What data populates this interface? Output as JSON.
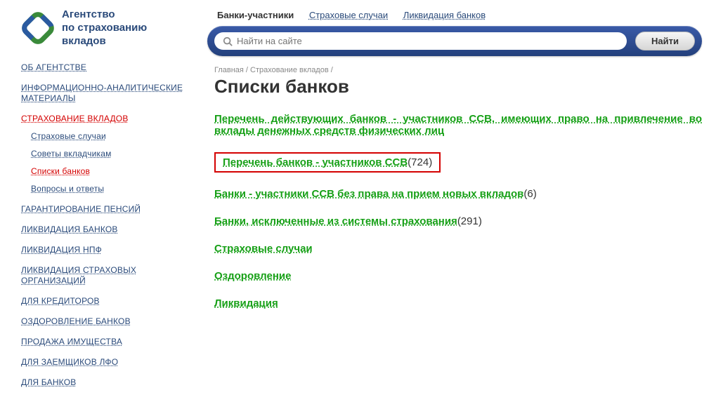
{
  "logo": {
    "line1": "Агентство",
    "line2": "по страхованию",
    "line3": "вкладов"
  },
  "top_nav": {
    "active": "Банки-участники",
    "link1": "Страховые случаи",
    "link2": "Ликвидация банков"
  },
  "search": {
    "placeholder": "Найти на сайте",
    "button": "Найти"
  },
  "sidebar": {
    "items": [
      {
        "label": "ОБ АГЕНТСТВЕ"
      },
      {
        "label": "ИНФОРМАЦИОННО-АНАЛИТИЧЕСКИЕ МАТЕРИАЛЫ"
      },
      {
        "label": "СТРАХОВАНИЕ ВКЛАДОВ",
        "sub": [
          {
            "label": "Страховые случаи"
          },
          {
            "label": "Советы вкладчикам"
          },
          {
            "label": "Списки банков",
            "active": true
          },
          {
            "label": "Вопросы и ответы"
          }
        ]
      },
      {
        "label": "ГАРАНТИРОВАНИЕ ПЕНСИЙ"
      },
      {
        "label": "ЛИКВИДАЦИЯ БАНКОВ"
      },
      {
        "label": "ЛИКВИДАЦИЯ НПФ"
      },
      {
        "label": "ЛИКВИДАЦИЯ СТРАХОВЫХ ОРГАНИЗАЦИЙ"
      },
      {
        "label": "ДЛЯ КРЕДИТОРОВ"
      },
      {
        "label": "ОЗДОРОВЛЕНИЕ БАНКОВ"
      },
      {
        "label": "ПРОДАЖА ИМУЩЕСТВА"
      },
      {
        "label": "ДЛЯ ЗАЕМЩИКОВ ЛФО"
      },
      {
        "label": "ДЛЯ БАНКОВ"
      }
    ]
  },
  "breadcrumb": {
    "home": "Главная",
    "section": "Страхование вкладов",
    "sep": " / "
  },
  "page": {
    "title": "Списки банков"
  },
  "links": [
    {
      "text": "Перечень действующих банков - участников ССВ, имеющих право на привлечение во вклады денежных средств физических лиц",
      "justify": true
    },
    {
      "text": "Перечень банков - участников ССВ",
      "count": "(724)",
      "highlight": true
    },
    {
      "text": "Банки - участники ССВ без права на прием новых вкладов",
      "count": "(6)"
    },
    {
      "text": "Банки, исключенные из системы страхования",
      "count": "(291)"
    },
    {
      "text": "Страховые случаи"
    },
    {
      "text": "Оздоровление"
    },
    {
      "text": "Ликвидация"
    }
  ]
}
